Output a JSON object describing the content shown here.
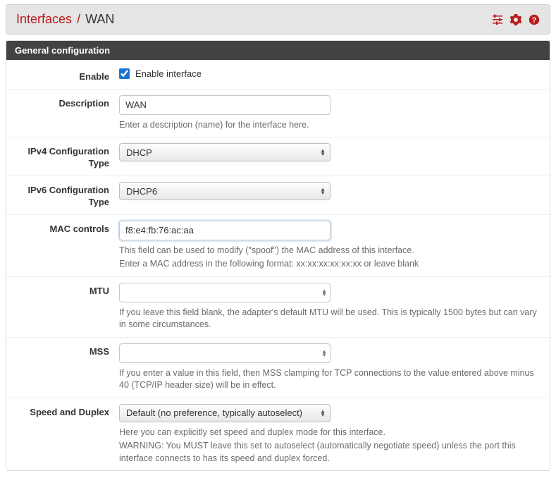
{
  "header": {
    "crumb_root": "Interfaces",
    "crumb_sep": "/",
    "crumb_leaf": "WAN"
  },
  "panel_title": "General configuration",
  "rows": {
    "enable": {
      "label": "Enable",
      "checked": true,
      "checkbox_label": "Enable interface"
    },
    "description": {
      "label": "Description",
      "value": "WAN",
      "help": "Enter a description (name) for the interface here."
    },
    "ipv4_type": {
      "label": "IPv4 Configuration Type",
      "value": "DHCP"
    },
    "ipv6_type": {
      "label": "IPv6 Configuration Type",
      "value": "DHCP6"
    },
    "mac": {
      "label": "MAC controls",
      "value": "f8:e4:fb:76:ac:aa",
      "help1": "This field can be used to modify (\"spoof\") the MAC address of this interface.",
      "help2": "Enter a MAC address in the following format: xx:xx:xx:xx:xx:xx or leave blank"
    },
    "mtu": {
      "label": "MTU",
      "value": "",
      "help": "If you leave this field blank, the adapter's default MTU will be used. This is typically 1500 bytes but can vary in some circumstances."
    },
    "mss": {
      "label": "MSS",
      "value": "",
      "help": "If you enter a value in this field, then MSS clamping for TCP connections to the value entered above minus 40 (TCP/IP header size) will be in effect."
    },
    "speed": {
      "label": "Speed and Duplex",
      "value": "Default (no preference, typically autoselect)",
      "help1": "Here you can explicitly set speed and duplex mode for this interface.",
      "help2": "WARNING: You MUST leave this set to autoselect (automatically negotiate speed) unless the port this interface connects to has its speed and duplex forced."
    }
  }
}
